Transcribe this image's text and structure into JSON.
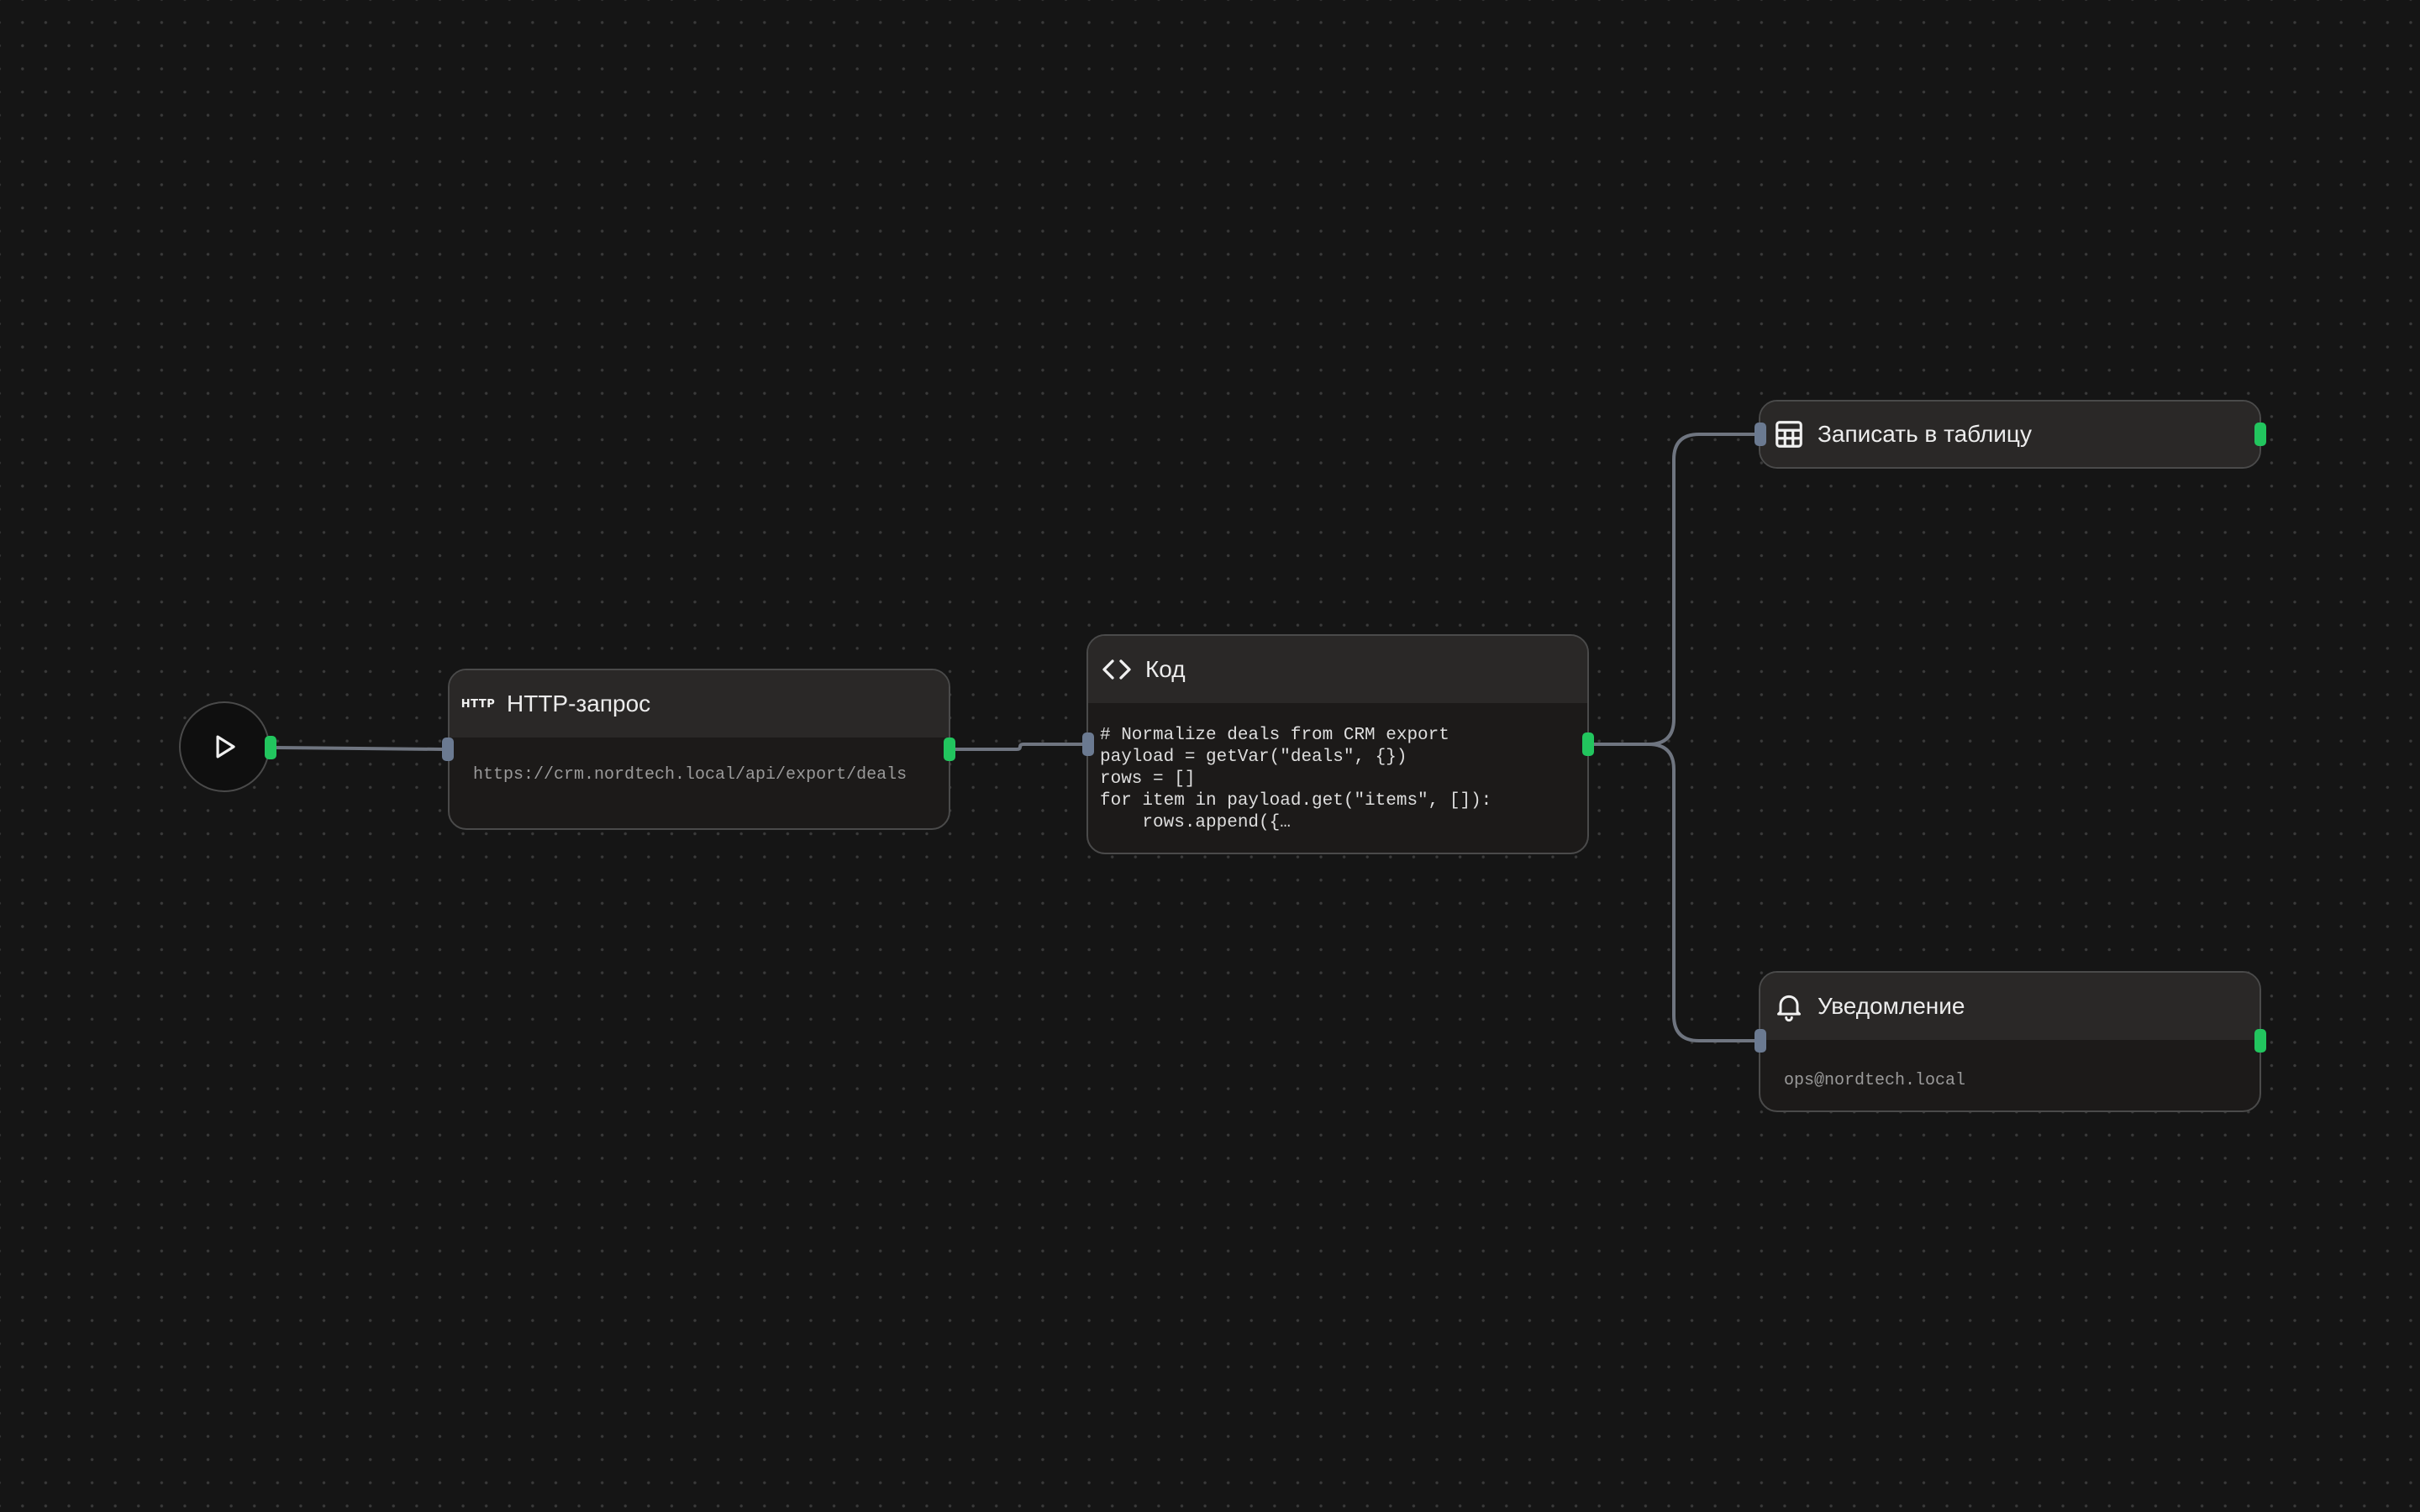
{
  "colors": {
    "canvas_bg": "#151515",
    "grid_dot": "#3a3a3a",
    "node_bg": "#1c1a19",
    "node_header_bg": "#2a2827",
    "node_border": "#4a4a4a",
    "edge": "#6f7580",
    "handle_output": "#22c55e",
    "handle_input": "#6b7a91"
  },
  "nodes": {
    "start": {
      "icon": "play-icon"
    },
    "http": {
      "icon": "http-badge-icon",
      "badge": "HTTP",
      "title": "HTTP-запрос",
      "url": "https://crm.nordtech.local/api/export/deals"
    },
    "code": {
      "icon": "code-brackets-icon",
      "title": "Код",
      "code": "# Normalize deals from CRM export\npayload = getVar(\"deals\", {})\nrows = []\nfor item in payload.get(\"items\", []):\n    rows.append({…"
    },
    "sheet": {
      "icon": "table-icon",
      "title": "Записать в таблицу"
    },
    "notify": {
      "icon": "bell-icon",
      "title": "Уведомление",
      "recipient": "ops@nordtech.local"
    }
  }
}
